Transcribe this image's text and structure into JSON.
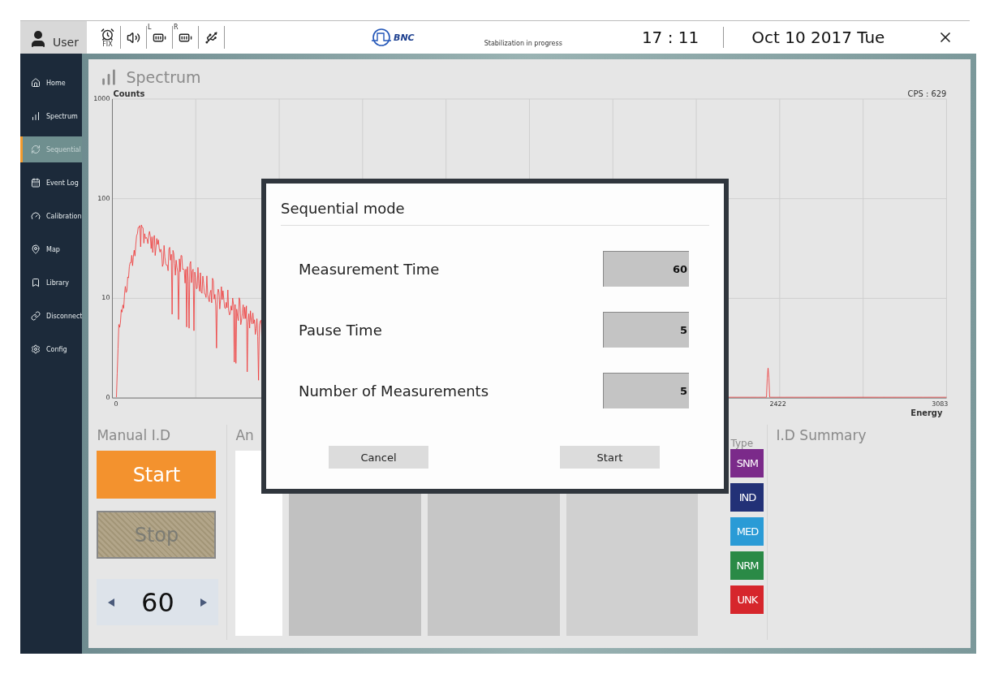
{
  "top_bar": {
    "user": "User",
    "status_icons": [
      {
        "kind": "alarm",
        "label": "FIX"
      },
      {
        "kind": "speaker"
      },
      {
        "kind": "battery",
        "label": "L"
      },
      {
        "kind": "battery",
        "label": "R"
      },
      {
        "kind": "usb"
      }
    ],
    "logo": "BNC",
    "status": "Stabilization in progress",
    "time": "17 : 11",
    "date": "Oct 10 2017 Tue"
  },
  "sidebar": {
    "items": [
      {
        "kind": "home",
        "label": "Home",
        "selected": false
      },
      {
        "kind": "spectrum",
        "label": "Spectrum",
        "selected": false
      },
      {
        "kind": "sequential",
        "label": "Sequential",
        "selected": true
      },
      {
        "kind": "eventlog",
        "label": "Event Log",
        "selected": false
      },
      {
        "kind": "calibration",
        "label": "Calibration",
        "selected": false
      },
      {
        "kind": "map",
        "label": "Map",
        "selected": false
      },
      {
        "kind": "library",
        "label": "Library",
        "selected": false
      },
      {
        "kind": "disconnect",
        "label": "Disconnect",
        "selected": false
      },
      {
        "kind": "config",
        "label": "Config",
        "selected": false
      }
    ]
  },
  "spectrum": {
    "title": "Spectrum",
    "ylabel": "Counts",
    "xlabel": "Energy",
    "cps": "CPS : 629",
    "yticks": [
      "1000",
      "100",
      "10",
      "0"
    ],
    "xticks": [
      "0",
      "2422",
      "3083"
    ]
  },
  "manual_id": {
    "title": "Manual I.D",
    "start": "Start",
    "stop": {
      "label": "Stop",
      "disabled": true
    },
    "duration": "60"
  },
  "analysis": {
    "title": "An"
  },
  "type": {
    "title": "Type",
    "badges": [
      {
        "label": "SNM",
        "color": "#7b2a8a"
      },
      {
        "label": "IND",
        "color": "#223177"
      },
      {
        "label": "MED",
        "color": "#2a9bd6"
      },
      {
        "label": "NRM",
        "color": "#2a8a46"
      },
      {
        "label": "UNK",
        "color": "#d6262c"
      }
    ]
  },
  "id_summary": {
    "title": "I.D Summary"
  },
  "dialog": {
    "title": "Sequential mode",
    "fields": [
      {
        "label": "Measurement Time",
        "value": "60"
      },
      {
        "label": "Pause Time",
        "value": "5"
      },
      {
        "label": "Number of Measurements",
        "value": "5"
      }
    ],
    "buttons": [
      "Cancel",
      "Start"
    ]
  }
}
